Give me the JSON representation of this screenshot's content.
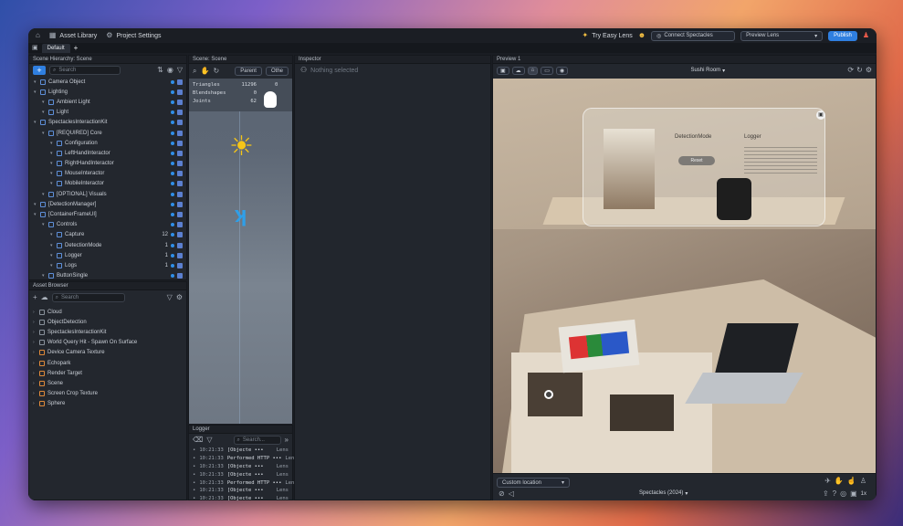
{
  "topbar": {
    "asset_library": "Asset Library",
    "project_settings": "Project Settings",
    "try_easy_lens": "Try Easy Lens",
    "connect": "Connect Spectacles",
    "preview_lens": "Preview Lens",
    "publish": "Publish"
  },
  "tabs": {
    "default": "Default"
  },
  "hierarchy": {
    "title": "Scene Hierarchy: Scene",
    "search": "Search",
    "items": [
      {
        "label": "Camera Object",
        "indent": 1
      },
      {
        "label": "Lighting",
        "indent": 1
      },
      {
        "label": "Ambient Light",
        "indent": 2
      },
      {
        "label": "Light",
        "indent": 2
      },
      {
        "label": "SpectaclesInteractionKit",
        "indent": 1
      },
      {
        "label": "[REQUIRED] Core",
        "indent": 2
      },
      {
        "label": "Configuration",
        "indent": 3
      },
      {
        "label": "LeftHandInteractor",
        "indent": 3
      },
      {
        "label": "RightHandInteractor",
        "indent": 3
      },
      {
        "label": "MouseInteractor",
        "indent": 3
      },
      {
        "label": "MobileInteractor",
        "indent": 3
      },
      {
        "label": "[OPTIONAL] Visuals",
        "indent": 2
      },
      {
        "label": "[DetectionManager]",
        "indent": 1
      },
      {
        "label": "[ContainerFrameUI]",
        "indent": 1
      },
      {
        "label": "Controls",
        "indent": 2
      },
      {
        "label": "Capture",
        "indent": 3,
        "num": "12"
      },
      {
        "label": "DetectionMode",
        "indent": 3,
        "num": "1"
      },
      {
        "label": "Logger",
        "indent": 3,
        "num": "1"
      },
      {
        "label": "Logs",
        "indent": 3,
        "num": "1"
      },
      {
        "label": "ButtonSingle",
        "indent": 2
      }
    ]
  },
  "assets": {
    "title": "Asset Browser",
    "search": "Search",
    "items": [
      "Cloud",
      "ObjectDetection",
      "SpectaclesInteractionKit",
      "World Query Hit - Spawn On Surface",
      "Device Camera Texture",
      "Echopark",
      "Render Target",
      "Scene",
      "Screen Crop Texture",
      "Sphere"
    ]
  },
  "scene": {
    "title": "Scene: Scene",
    "parent_btn": "Parent",
    "other_btn": "Othe",
    "stats": [
      {
        "k": "Triangles",
        "v": "11296"
      },
      {
        "k": "Blendshapes",
        "v": "0"
      },
      {
        "k": "Joints",
        "v": "62"
      }
    ],
    "stat_extra": "0"
  },
  "logger": {
    "title": "Logger",
    "search": "Search...",
    "rows": [
      {
        "t": "10:21:33",
        "m": "[Objecte •••",
        "s": "Lens"
      },
      {
        "t": "10:21:33",
        "m": "Performed HTTP •••",
        "s": "Lens"
      },
      {
        "t": "10:21:33",
        "m": "[Objecte •••",
        "s": "Lens"
      },
      {
        "t": "10:21:33",
        "m": "[Objecte •••",
        "s": "Lens"
      },
      {
        "t": "10:21:33",
        "m": "Performed HTTP •••",
        "s": "Lens"
      },
      {
        "t": "10:21:33",
        "m": "[Objecte •••",
        "s": "Lens"
      },
      {
        "t": "10:21:33",
        "m": "[Objecte •••",
        "s": "Lens"
      },
      {
        "t": "10:21:33",
        "m": "[Objecte •••",
        "s": "Lens"
      }
    ]
  },
  "inspector": {
    "title": "Inspector",
    "empty": "Nothing selected"
  },
  "preview": {
    "title": "Preview 1",
    "room": "Sushi Room",
    "card_title": "DetectionMode",
    "card_logger": "Logger",
    "card_btn": "Reset",
    "location": "Custom location",
    "device": "Spectacles (2024)",
    "zoom": "1x"
  }
}
